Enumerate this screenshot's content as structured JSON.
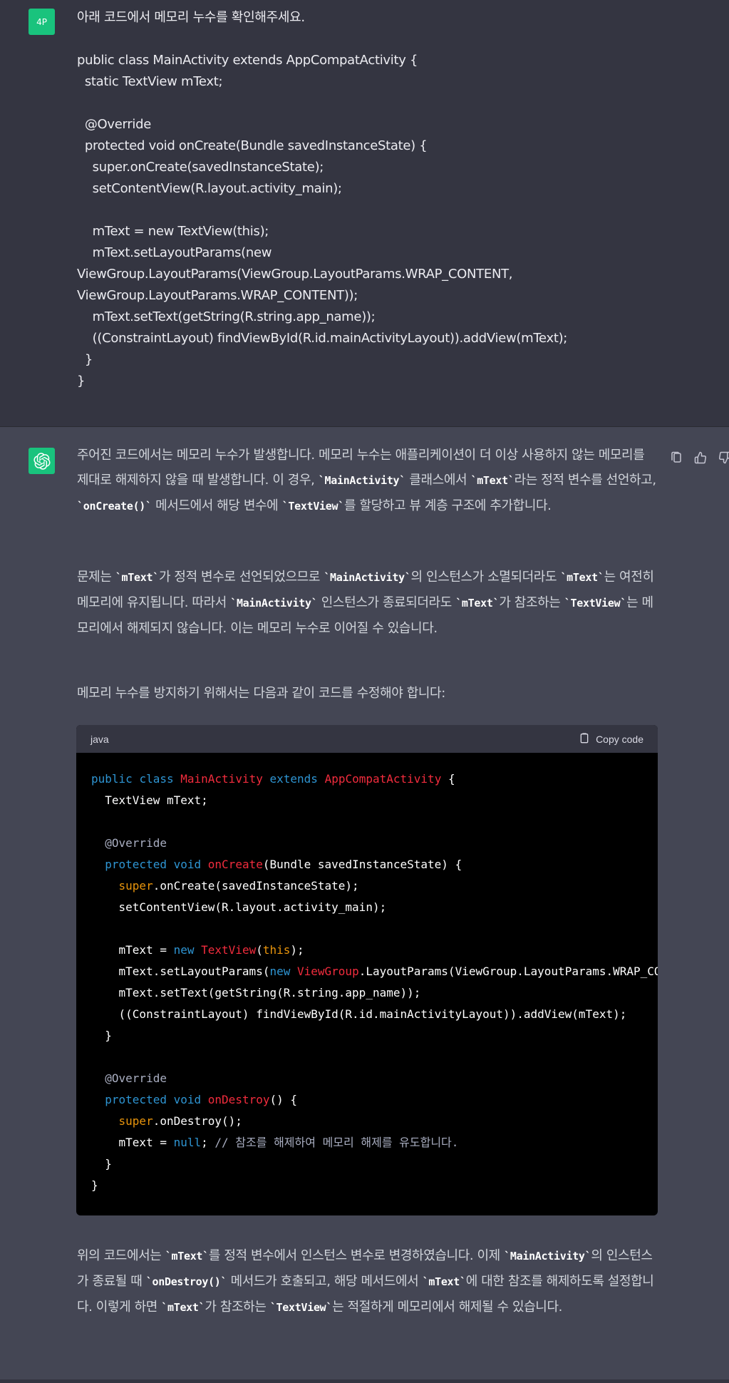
{
  "user": {
    "avatar_label": "4P",
    "lines": [
      "아래 코드에서 메모리 누수를 확인해주세요.",
      "",
      "public class MainActivity extends AppCompatActivity {",
      "  static TextView mText;",
      "",
      "  @Override",
      "  protected void onCreate(Bundle savedInstanceState) {",
      "    super.onCreate(savedInstanceState);",
      "    setContentView(R.layout.activity_main);",
      "",
      "    mText = new TextView(this);",
      "    mText.setLayoutParams(new",
      "ViewGroup.LayoutParams(ViewGroup.LayoutParams.WRAP_CONTENT,",
      "ViewGroup.LayoutParams.WRAP_CONTENT));",
      "    mText.setText(getString(R.string.app_name));",
      "    ((ConstraintLayout) findViewById(R.id.mainActivityLayout)).addView(mText);",
      "  }",
      "}"
    ]
  },
  "assistant": {
    "avatar_icon": "openai-logo-icon",
    "p1": {
      "a": "주어진 코드에서는 메모리 누수가 발생합니다. 메모리 누수는 애플리케이션이 더 이상 사용하지 않는 메모리를 제대로 해제하지 않을 때 발생합니다. 이 경우, ",
      "c1": "`MainActivity`",
      "b": " 클래스에서 ",
      "c2": "`mText`",
      "c": "라는 정적 변수를 선언하고, ",
      "c3": "`onCreate()`",
      "d": " 메서드에서 해당 변수에 ",
      "c4": "`TextView`",
      "e": "를 할당하고 뷰 계층 구조에 추가합니다."
    },
    "p2": {
      "a": "문제는 ",
      "c1": "`mText`",
      "b": "가 정적 변수로 선언되었으므로 ",
      "c2": "`MainActivity`",
      "c": "의 인스턴스가 소멸되더라도 ",
      "c3": "`mText`",
      "d": "는 여전히 메모리에 유지됩니다. 따라서 ",
      "c4": "`MainActivity`",
      "e": " 인스턴스가 종료되더라도 ",
      "c5": "`mText`",
      "f": "가 참조하는 ",
      "c6": "`TextView`",
      "g": "는 메모리에서 해제되지 않습니다. 이는 메모리 누수로 이어질 수 있습니다."
    },
    "p3": "메모리 누수를 방지하기 위해서는 다음과 같이 코드를 수정해야 합니다:",
    "code": {
      "lang": "java",
      "copy_label": "Copy code"
    },
    "p4": {
      "a": "위의 코드에서는 ",
      "c1": "`mText`",
      "b": "를 정적 변수에서 인스턴스 변수로 변경하였습니다. 이제 ",
      "c2": "`MainActivity`",
      "c": "의 인스턴스가 종료될 때 ",
      "c3": "`onDestroy()`",
      "d": " 메서드가 호출되고, 해당 메서드에서 ",
      "c4": "`mText`",
      "e": "에 대한 참조를 해제하도록 설정합니다. 이렇게 하면 ",
      "c5": "`mText`",
      "f": "가 참조하는 ",
      "c6": "`TextView`",
      "g": "는 적절하게 메모리에서 해제될 수 있습니다."
    },
    "actions": [
      "copy-icon",
      "thumbs-up-icon",
      "thumbs-down-icon"
    ]
  },
  "code_lines": [
    [
      [
        "kw",
        "public"
      ],
      [
        "t",
        " "
      ],
      [
        "kw",
        "class"
      ],
      [
        "t",
        " "
      ],
      [
        "cls",
        "MainActivity"
      ],
      [
        "t",
        " "
      ],
      [
        "kw",
        "extends"
      ],
      [
        "t",
        " "
      ],
      [
        "cls",
        "AppCompatActivity"
      ],
      [
        "t",
        " {"
      ]
    ],
    [
      [
        "t",
        "  TextView mText;"
      ]
    ],
    [
      [
        "t",
        ""
      ]
    ],
    [
      [
        "an",
        "  @Override"
      ]
    ],
    [
      [
        "t",
        "  "
      ],
      [
        "kw",
        "protected"
      ],
      [
        "t",
        " "
      ],
      [
        "kw",
        "void"
      ],
      [
        "t",
        " "
      ],
      [
        "fn",
        "onCreate"
      ],
      [
        "t",
        "(Bundle savedInstanceState) {"
      ]
    ],
    [
      [
        "t",
        "    "
      ],
      [
        "sp",
        "super"
      ],
      [
        "t",
        ".onCreate(savedInstanceState);"
      ]
    ],
    [
      [
        "t",
        "    setContentView(R.layout.activity_main);"
      ]
    ],
    [
      [
        "t",
        ""
      ]
    ],
    [
      [
        "t",
        "    mText = "
      ],
      [
        "kw",
        "new"
      ],
      [
        "t",
        " "
      ],
      [
        "cls",
        "TextView"
      ],
      [
        "t",
        "("
      ],
      [
        "sp",
        "this"
      ],
      [
        "t",
        ");"
      ]
    ],
    [
      [
        "t",
        "    mText.setLayoutParams("
      ],
      [
        "kw",
        "new"
      ],
      [
        "t",
        " "
      ],
      [
        "cls",
        "ViewGroup"
      ],
      [
        "t",
        ".LayoutParams(ViewGroup.LayoutParams.WRAP_CONTENT, ViewGroup.LayoutParams.WRAP_CONTENT));"
      ]
    ],
    [
      [
        "t",
        "    mText.setText(getString(R.string.app_name));"
      ]
    ],
    [
      [
        "t",
        "    ((ConstraintLayout) findViewById(R.id.mainActivityLayout)).addView(mText);"
      ]
    ],
    [
      [
        "t",
        "  }"
      ]
    ],
    [
      [
        "t",
        ""
      ]
    ],
    [
      [
        "an",
        "  @Override"
      ]
    ],
    [
      [
        "t",
        "  "
      ],
      [
        "kw",
        "protected"
      ],
      [
        "t",
        " "
      ],
      [
        "kw",
        "void"
      ],
      [
        "t",
        " "
      ],
      [
        "fn",
        "onDestroy"
      ],
      [
        "t",
        "() {"
      ]
    ],
    [
      [
        "t",
        "    "
      ],
      [
        "sp",
        "super"
      ],
      [
        "t",
        ".onDestroy();"
      ]
    ],
    [
      [
        "t",
        "    mText = "
      ],
      [
        "kw",
        "null"
      ],
      [
        "t",
        "; "
      ],
      [
        "cm",
        "// 참조를 해제하여 메모리 해제를 유도합니다."
      ]
    ],
    [
      [
        "t",
        "  }"
      ]
    ],
    [
      [
        "t",
        "}"
      ]
    ]
  ]
}
